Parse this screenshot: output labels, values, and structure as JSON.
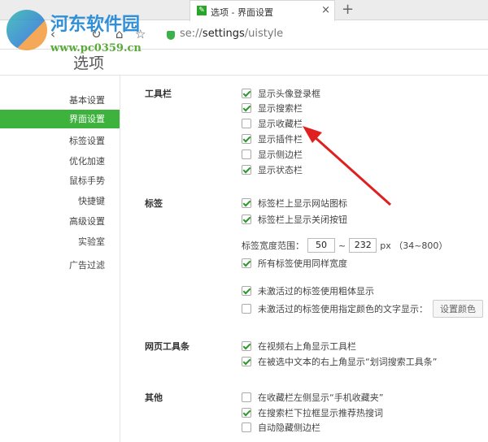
{
  "tab": {
    "title": "选项 - 界面设置",
    "close": "×",
    "new": "+"
  },
  "address": {
    "scheme": "se://",
    "host": "settings",
    "path": "/uistyle"
  },
  "nav": {
    "back": "‹",
    "reload": "↻",
    "home": "⌂",
    "star": "☆"
  },
  "page_title": "选项",
  "sidebar": [
    "基本设置",
    "界面设置",
    "标签设置",
    "优化加速",
    "鼠标手势",
    "快捷键",
    "高级设置",
    "实验室",
    "广告过滤"
  ],
  "sections": {
    "toolbar": {
      "label": "工具栏",
      "items": [
        {
          "text": "显示头像登录框",
          "checked": true
        },
        {
          "text": "显示搜索栏",
          "checked": true
        },
        {
          "text": "显示收藏栏",
          "checked": false
        },
        {
          "text": "显示插件栏",
          "checked": true
        },
        {
          "text": "显示侧边栏",
          "checked": false
        },
        {
          "text": "显示状态栏",
          "checked": true
        }
      ]
    },
    "tabs": {
      "label": "标签",
      "items": [
        {
          "text": "标签栏上显示网站图标",
          "checked": true
        },
        {
          "text": "标签栏上显示关闭按钮",
          "checked": true
        }
      ],
      "width_label": "标签宽度范围：",
      "min": "50",
      "sep": "~",
      "max": "232",
      "unit": "px （34~800）",
      "same_width": "所有标签使用同样宽度",
      "bold": "未激活过的标签使用粗体显示",
      "color_text": "未激活过的标签使用指定颜色的文字显示：",
      "color_btn": "设置颜色"
    },
    "webbar": {
      "label": "网页工具条",
      "items": [
        {
          "text": "在视频右上角显示工具栏",
          "checked": true
        },
        {
          "text": "在被选中文本的右上角显示“划词搜索工具条”",
          "checked": true
        }
      ]
    },
    "other": {
      "label": "其他",
      "items": [
        {
          "text": "在收藏栏左侧显示“手机收藏夹”",
          "checked": false
        },
        {
          "text": "在搜索栏下拉框显示推荐热搜词",
          "checked": true
        },
        {
          "text": "自动隐藏侧边栏",
          "checked": false
        }
      ]
    }
  },
  "watermark": {
    "name": "河东软件园",
    "url": "www.pc0359.cn"
  },
  "colors": {
    "accent": "#3db23d",
    "arrow": "#e02020"
  }
}
